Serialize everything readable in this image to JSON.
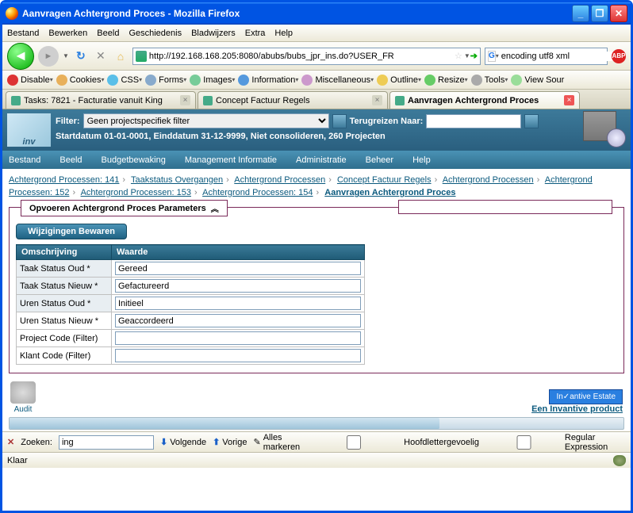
{
  "window": {
    "title": "Aanvragen Achtergrond Proces - Mozilla Firefox"
  },
  "browser_menu": {
    "bestand": "Bestand",
    "bewerken": "Bewerken",
    "beeld": "Beeld",
    "geschiedenis": "Geschiedenis",
    "bladwijzers": "Bladwijzers",
    "extra": "Extra",
    "help": "Help"
  },
  "url": "http://192.168.168.205:8080/abubs/bubs_jpr_ins.do?USER_FR",
  "search": {
    "value": "encoding utf8 xml",
    "engine": "G"
  },
  "devtoolbar": {
    "disable": "Disable",
    "cookies": "Cookies",
    "css": "CSS",
    "forms": "Forms",
    "images": "Images",
    "information": "Information",
    "miscellaneous": "Miscellaneous",
    "outline": "Outline",
    "resize": "Resize",
    "tools": "Tools",
    "viewsource": "View Sour"
  },
  "tabs": [
    {
      "title": "Tasks: 7821 - Facturatie vanuit King",
      "active": false
    },
    {
      "title": "Concept Factuur Regels",
      "active": false
    },
    {
      "title": "Aanvragen Achtergrond Proces",
      "active": true
    }
  ],
  "filter": {
    "label": "Filter:",
    "selected": "Geen projectspecifiek filter",
    "travel_label": "Terugreizen Naar:",
    "status": "Startdatum 01-01-0001, Einddatum 31-12-9999, Niet consolideren, 260 Projecten"
  },
  "app_menu": {
    "bestand": "Bestand",
    "beeld": "Beeld",
    "budget": "Budgetbewaking",
    "mgmt": "Management Informatie",
    "admin": "Administratie",
    "beheer": "Beheer",
    "help": "Help"
  },
  "crumbs": [
    "Achtergrond Processen: 141",
    "Taakstatus Overgangen",
    "Achtergrond Processen",
    "Concept Factuur Regels",
    "Achtergrond Processen",
    "Achtergrond Processen: 152",
    "Achtergrond Processen: 153",
    "Achtergrond Processen: 154"
  ],
  "crumbs_current": "Aanvragen Achtergrond Proces",
  "fieldset": {
    "legend": "Opvoeren Achtergrond Proces Parameters",
    "save_btn": "Wijzigingen Bewaren",
    "col1": "Omschrijving",
    "col2": "Waarde",
    "rows": [
      {
        "label": "Taak Status Oud *",
        "value": "Gereed"
      },
      {
        "label": "Taak Status Nieuw *",
        "value": "Gefactureerd"
      },
      {
        "label": "Uren Status Oud *",
        "value": "Initieel"
      },
      {
        "label": "Uren Status Nieuw *",
        "value": "Geaccordeerd"
      },
      {
        "label": "Project Code (Filter)",
        "value": ""
      },
      {
        "label": "Klant Code (Filter)",
        "value": ""
      }
    ]
  },
  "audit_label": "Audit",
  "invantive": {
    "logo": "In✓antive Estate",
    "link": "Een Invantive product"
  },
  "findbar": {
    "label": "Zoeken:",
    "value": "ing",
    "next": "Volgende",
    "prev": "Vorige",
    "markall": "Alles markeren",
    "matchcase": "Hoofdlettergevoelig",
    "regex": "Regular Expression"
  },
  "status": "Klaar"
}
